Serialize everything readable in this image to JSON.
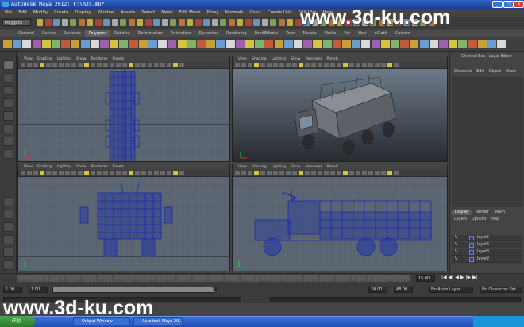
{
  "window": {
    "title": "Autodesk Maya 2012: F:\\m35.mb*"
  },
  "menu": [
    "File",
    "Edit",
    "Modify",
    "Create",
    "Display",
    "Window",
    "Assets",
    "Select",
    "Mesh",
    "Edit Mesh",
    "Proxy",
    "Normals",
    "Color",
    "Create UVs",
    "Edit UVs",
    "Help"
  ],
  "status": {
    "mode": "Polygons"
  },
  "shelf_tabs": [
    "General",
    "Curves",
    "Surfaces",
    "Polygons",
    "Subdivs",
    "Deformation",
    "Animation",
    "Dynamics",
    "Rendering",
    "PaintEffects",
    "Toon",
    "Muscle",
    "Fluids",
    "Fur",
    "Hair",
    "nCloth",
    "Custom"
  ],
  "viewport_menu": [
    "View",
    "Shading",
    "Lighting",
    "Show",
    "Renderer",
    "Panels"
  ],
  "channel_box": {
    "title": "Channel Box / Layer Editor",
    "tabs": [
      "Channels",
      "Edit",
      "Object",
      "Show"
    ]
  },
  "layer_editor": {
    "tabs": [
      "Display",
      "Render",
      "Anim"
    ],
    "menu": [
      "Layers",
      "Options",
      "Help"
    ],
    "layers": [
      {
        "visible": "V",
        "name": "layer5"
      },
      {
        "visible": "V",
        "name": "layer4"
      },
      {
        "visible": "V",
        "name": "layer3"
      },
      {
        "visible": "V",
        "name": "layer2"
      }
    ]
  },
  "timeline": {
    "end_field": "15.00"
  },
  "range": {
    "start": "1.00",
    "inner_start": "1.00",
    "inner_end": "24",
    "end": "24.00",
    "end2": "48.00",
    "anim_layer": "No Anim Layer",
    "char_set": "No Character Set"
  },
  "taskbar": {
    "start": "开始",
    "tasks": [
      "Output Window",
      "Autodesk Maya 20..."
    ]
  },
  "watermarks": [
    "www.3d-ku.com",
    "www.3d-ku.com"
  ],
  "colors": {
    "wire": "#1b2bb0",
    "viewport_bg": "#5a6571"
  }
}
